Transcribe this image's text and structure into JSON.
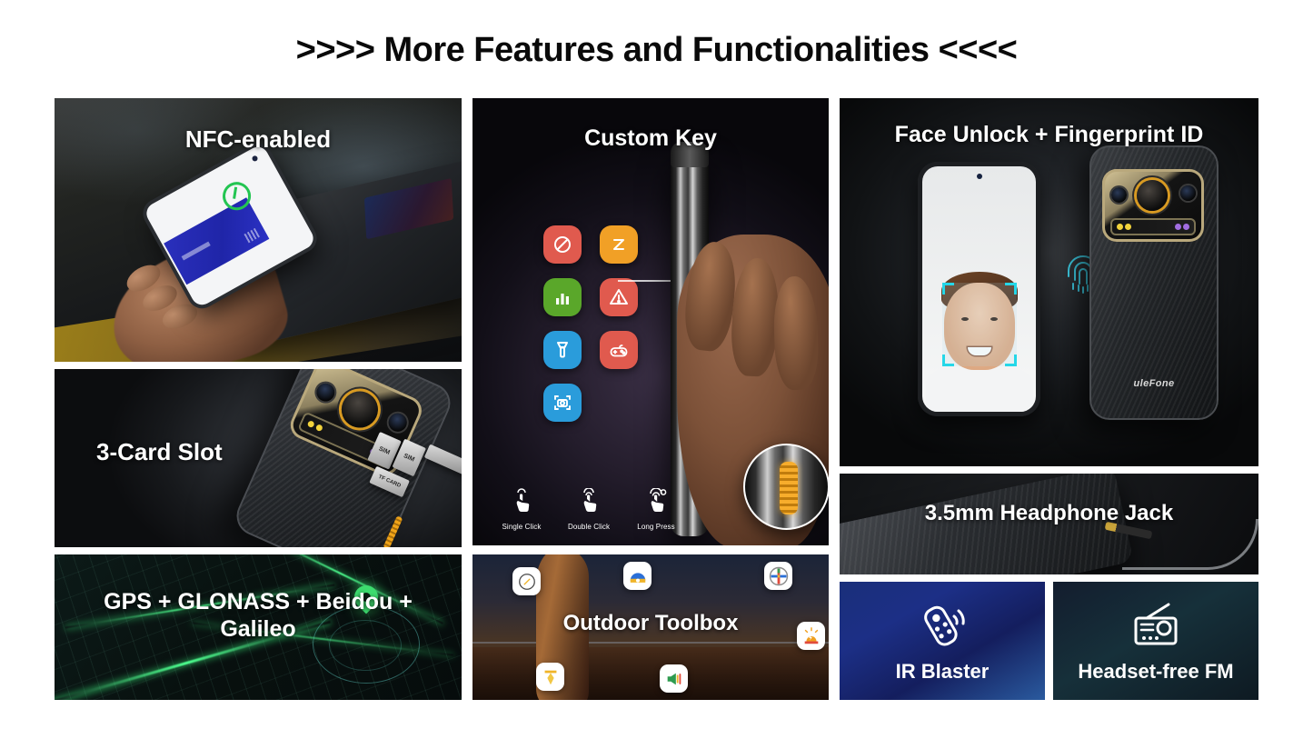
{
  "header": {
    "title": ">>>> More Features and Functionalities <<<<"
  },
  "panels": {
    "nfc": {
      "title": "NFC-enabled"
    },
    "card_slot": {
      "title": "3-Card Slot",
      "tray_labels": [
        "SIM",
        "SIM",
        "TF CARD"
      ]
    },
    "gps": {
      "title": "GPS + GLONASS + Beidou + Galileo"
    },
    "custom_key": {
      "title": "Custom Key",
      "shortcut_icons": [
        {
          "name": "do-not-disturb-icon",
          "color": "#e05a4e"
        },
        {
          "name": "sleep-mode-icon",
          "color": "#f1a026"
        },
        {
          "name": "bar-chart-icon",
          "color": "#5aa72a"
        },
        {
          "name": "warning-triangle-icon",
          "color": "#e05a4e"
        },
        {
          "name": "flashlight-icon",
          "color": "#2a9cdb"
        },
        {
          "name": "game-controller-icon",
          "color": "#e05a4e"
        },
        {
          "name": "camera-scan-icon",
          "color": "#2a9cdb"
        }
      ],
      "gestures": [
        {
          "label": "Single Click",
          "icon": "tap-single-icon"
        },
        {
          "label": "Double Click",
          "icon": "tap-double-icon"
        },
        {
          "label": "Long Press",
          "icon": "tap-long-icon"
        }
      ]
    },
    "toolbox": {
      "title": "Outdoor Toolbox",
      "app_icons": [
        {
          "name": "compass-icon"
        },
        {
          "name": "protractor-icon"
        },
        {
          "name": "crosshair-icon"
        },
        {
          "name": "plumb-bob-icon"
        },
        {
          "name": "loudspeaker-icon"
        },
        {
          "name": "siren-alarm-icon"
        }
      ]
    },
    "face_unlock": {
      "title": "Face Unlock + Fingerprint ID",
      "brand": "uleFone"
    },
    "headphone_jack": {
      "title": "3.5mm Headphone Jack"
    },
    "ir_blaster": {
      "title": "IR Blaster",
      "icon": "remote-control-icon"
    },
    "fm_radio": {
      "title": "Headset-free FM",
      "icon": "radio-icon"
    }
  }
}
